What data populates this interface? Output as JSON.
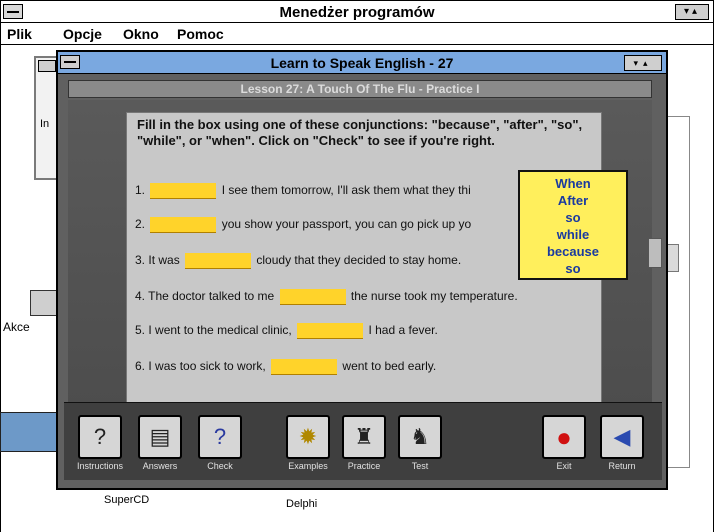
{
  "program_manager": {
    "title": "Menedżer programów",
    "menu": [
      "Plik",
      "Opcje",
      "Okno",
      "Pomoc"
    ]
  },
  "desktop": {
    "group_label": "In",
    "akc_label": "Akce",
    "supercd_label": "SuperCD",
    "delphi_label": "Delphi"
  },
  "app": {
    "title": "Learn to Speak English - 27",
    "lesson_title": "Lesson 27:  A Touch Of The Flu - Practice I",
    "instructions": "Fill in the box using one of these conjunctions: \"because\", \"after\", \"so\", \"while\", or \"when\".  Click on \"Check\" to see if you're right.",
    "sentences": [
      {
        "num": "1.",
        "before": "",
        "after": "I see them tomorrow, I'll ask them what they thi"
      },
      {
        "num": "2.",
        "before": "",
        "after": "you show your passport, you can go pick up yo"
      },
      {
        "num": "3.",
        "before": "It was",
        "after": "cloudy that they decided to stay home."
      },
      {
        "num": "4.",
        "before": "The doctor talked to me",
        "after": "the nurse took my temperature."
      },
      {
        "num": "5.",
        "before": "I went to the medical clinic,",
        "after": "I had a fever."
      },
      {
        "num": "6.",
        "before": "I was too sick to work,",
        "after": "went to bed early."
      }
    ],
    "word_box": [
      "When",
      "After",
      "so",
      "while",
      "because",
      "so"
    ],
    "buttons": [
      {
        "label": "Instructions",
        "icon": "instructions-icon"
      },
      {
        "label": "Answers",
        "icon": "answers-icon"
      },
      {
        "label": "Check",
        "icon": "check-icon"
      },
      {
        "label": "Examples",
        "icon": "examples-icon"
      },
      {
        "label": "Practice",
        "icon": "practice-icon"
      },
      {
        "label": "Test",
        "icon": "test-icon"
      },
      {
        "label": "Exit",
        "icon": "exit-icon"
      },
      {
        "label": "Return",
        "icon": "return-icon"
      }
    ]
  },
  "colors": {
    "title_blue": "#7aa8e0",
    "blank_yellow": "#ffd32a",
    "wordbox_yellow": "#ffef5c",
    "word_blue": "#1a3aa0"
  }
}
